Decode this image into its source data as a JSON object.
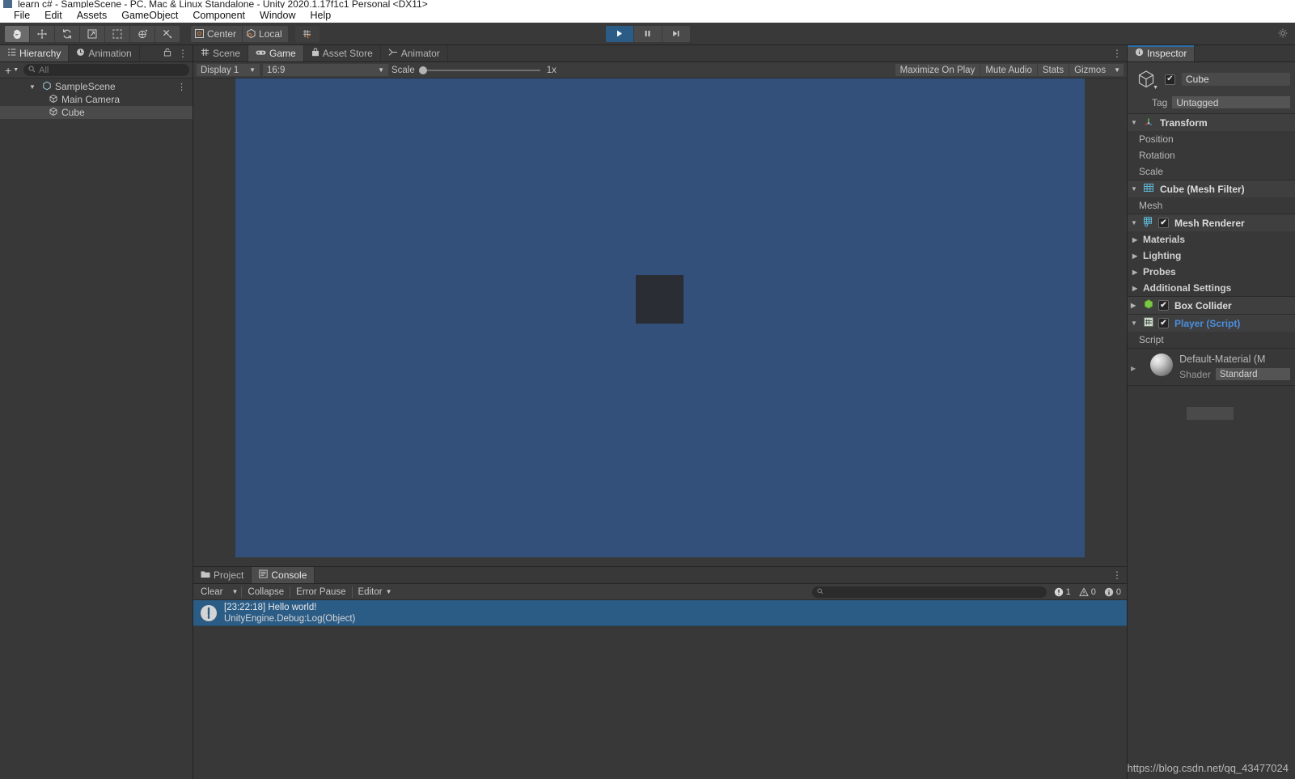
{
  "window": {
    "title": "learn c# - SampleScene - PC, Mac & Linux Standalone - Unity 2020.1.17f1c1 Personal <DX11>"
  },
  "menubar": {
    "items": [
      {
        "label": "File"
      },
      {
        "label": "Edit"
      },
      {
        "label": "Assets"
      },
      {
        "label": "GameObject"
      },
      {
        "label": "Component"
      },
      {
        "label": "Window"
      },
      {
        "label": "Help"
      }
    ]
  },
  "toolbar": {
    "tools": [
      {
        "name": "hand-tool",
        "active": true
      },
      {
        "name": "move-tool",
        "active": false
      },
      {
        "name": "rotate-tool",
        "active": false
      },
      {
        "name": "scale-tool",
        "active": false
      },
      {
        "name": "rect-tool",
        "active": false
      },
      {
        "name": "transform-tool",
        "active": false
      },
      {
        "name": "custom-tool",
        "active": false
      }
    ],
    "pivot_label": "Center",
    "space_label": "Local",
    "play_label": "play",
    "pause_label": "pause",
    "step_label": "step"
  },
  "hierarchy": {
    "tabs": [
      {
        "label": "Hierarchy",
        "icon": "hierarchy-icon",
        "active": true
      },
      {
        "label": "Animation",
        "icon": "clock-icon",
        "active": false
      }
    ],
    "search_placeholder": "All",
    "add_label": "+",
    "items": [
      {
        "label": "SampleScene",
        "depth": 0,
        "expanded": true,
        "selected": false,
        "icon": "scene-icon"
      },
      {
        "label": "Main Camera",
        "depth": 1,
        "expanded": false,
        "selected": false,
        "icon": "gameobject-icon"
      },
      {
        "label": "Cube",
        "depth": 1,
        "expanded": false,
        "selected": true,
        "icon": "gameobject-icon"
      }
    ]
  },
  "centerview": {
    "tabs": [
      {
        "label": "Scene",
        "icon": "scene-grid-icon",
        "active": false
      },
      {
        "label": "Game",
        "icon": "gamepad-icon",
        "active": true
      },
      {
        "label": "Asset Store",
        "icon": "store-icon",
        "active": false
      },
      {
        "label": "Animator",
        "icon": "animator-icon",
        "active": false
      }
    ],
    "display": "Display 1",
    "aspect": "16:9",
    "scale_label": "Scale",
    "scale_value": "1x",
    "buttons": [
      {
        "label": "Maximize On Play"
      },
      {
        "label": "Mute Audio"
      },
      {
        "label": "Stats"
      },
      {
        "label": "Gizmos"
      }
    ],
    "background_color": "#32507a",
    "object_color": "#2a2d33"
  },
  "inspector": {
    "tab_label": "Inspector",
    "object_name": "Cube",
    "object_enabled": true,
    "tag_label": "Tag",
    "tag_value": "Untagged",
    "components": [
      {
        "title": "Transform",
        "icon": "transform-icon",
        "expanded": true,
        "has_checkbox": false,
        "script": false,
        "properties": [
          {
            "label": "Position",
            "arrow": false
          },
          {
            "label": "Rotation",
            "arrow": false
          },
          {
            "label": "Scale",
            "arrow": false
          }
        ]
      },
      {
        "title": "Cube (Mesh Filter)",
        "icon": "mesh-filter-icon",
        "expanded": true,
        "has_checkbox": false,
        "script": false,
        "properties": [
          {
            "label": "Mesh",
            "arrow": false
          }
        ]
      },
      {
        "title": "Mesh Renderer",
        "icon": "mesh-renderer-icon",
        "expanded": true,
        "has_checkbox": true,
        "script": false,
        "properties": [
          {
            "label": "Materials",
            "arrow": true
          },
          {
            "label": "Lighting",
            "arrow": true
          },
          {
            "label": "Probes",
            "arrow": true
          },
          {
            "label": "Additional Settings",
            "arrow": true
          }
        ]
      },
      {
        "title": "Box Collider",
        "icon": "box-collider-icon",
        "expanded": false,
        "has_checkbox": true,
        "script": false,
        "properties": []
      },
      {
        "title": "Player (Script)",
        "icon": "script-icon",
        "expanded": true,
        "has_checkbox": true,
        "script": true,
        "properties": [
          {
            "label": "Script",
            "arrow": false
          }
        ]
      }
    ],
    "material": {
      "name": "Default-Material (M",
      "shader_label": "Shader",
      "shader_value": "Standard"
    }
  },
  "console": {
    "tabs": [
      {
        "label": "Project",
        "icon": "folder-icon",
        "active": false
      },
      {
        "label": "Console",
        "icon": "console-icon",
        "active": true
      }
    ],
    "clear_label": "Clear",
    "collapse_label": "Collapse",
    "error_pause_label": "Error Pause",
    "editor_label": "Editor",
    "error_count": "1",
    "warning_count": "0",
    "info_count": "0",
    "entries": [
      {
        "line1": "[23:22:18] Hello world!",
        "line2": "UnityEngine.Debug:Log(Object)",
        "selected": true,
        "icon": "info-log-icon"
      }
    ]
  },
  "watermark": {
    "text": "https://blog.csdn.net/qq_43477024"
  }
}
